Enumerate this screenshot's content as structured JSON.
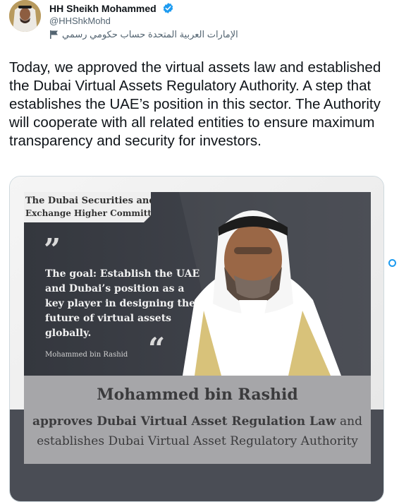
{
  "author": {
    "display_name": "HH Sheikh Mohammed",
    "handle": "@HHShkMohd",
    "account_label": "الإمارات العربية المتحدة حساب حكومي رسمي",
    "verified_icon": "verified-badge-icon",
    "label_icon": "flag-icon"
  },
  "tweet": {
    "text": "Today, we approved the virtual assets law and established the Dubai Virtual Assets Regulatory Authority. A step that establishes the UAE’s position in this sector. The Authority will cooperate with all related entities to ensure maximum transparency and security for investors."
  },
  "media": {
    "committee_line1": "The Dubai Securities and",
    "committee_line2": "Exchange Higher Committee",
    "quote_lines": [
      "The goal: Establish the UAE",
      "and Dubai’s position as a",
      "key player in designing the",
      "future of virtual assets",
      "globally."
    ],
    "quote_attribution": "Mohammed bin Rashid",
    "headline": "Mohammed bin Rashid",
    "sub_bold": "approves Dubai Virtual Asset Regulation Law",
    "sub_rest": "and",
    "sub_line2": "establishes Dubai Virtual Asset Regulatory Authority"
  },
  "colors": {
    "accent": "#1d9bf0",
    "panel_dark": "#3a3d45",
    "panel_grey": "#a3a3a6",
    "page_bg": "#ffffff"
  }
}
